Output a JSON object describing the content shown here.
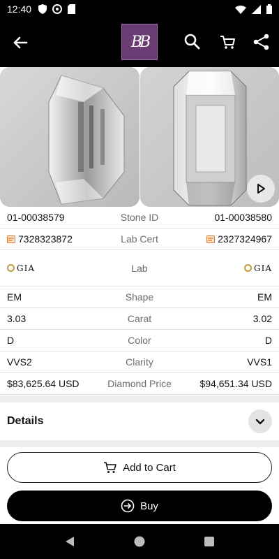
{
  "status": {
    "time": "12:40"
  },
  "header": {
    "logo_text": "BB"
  },
  "comparison": {
    "rows": [
      {
        "label": "Stone ID",
        "left": "01-00038579",
        "right": "01-00038580"
      },
      {
        "label": "Lab Cert",
        "left": "7328323872",
        "right": "2327324967"
      },
      {
        "label": "Lab",
        "left": "GIA",
        "right": "GIA"
      },
      {
        "label": "Shape",
        "left": "EM",
        "right": "EM"
      },
      {
        "label": "Carat",
        "left": "3.03",
        "right": "3.02"
      },
      {
        "label": "Color",
        "left": "D",
        "right": "D"
      },
      {
        "label": "Clarity",
        "left": "VVS2",
        "right": "VVS1"
      },
      {
        "label": "Diamond Price",
        "left": "$83,625.64 USD",
        "right": "$94,651.34 USD"
      }
    ]
  },
  "details": {
    "title": "Details"
  },
  "actions": {
    "add_to_cart": "Add to Cart",
    "buy": "Buy"
  },
  "colors": {
    "logo_bg": "#6b3b74",
    "gia_ring": "#c8963a",
    "cert_icon": "#e07a2e"
  }
}
